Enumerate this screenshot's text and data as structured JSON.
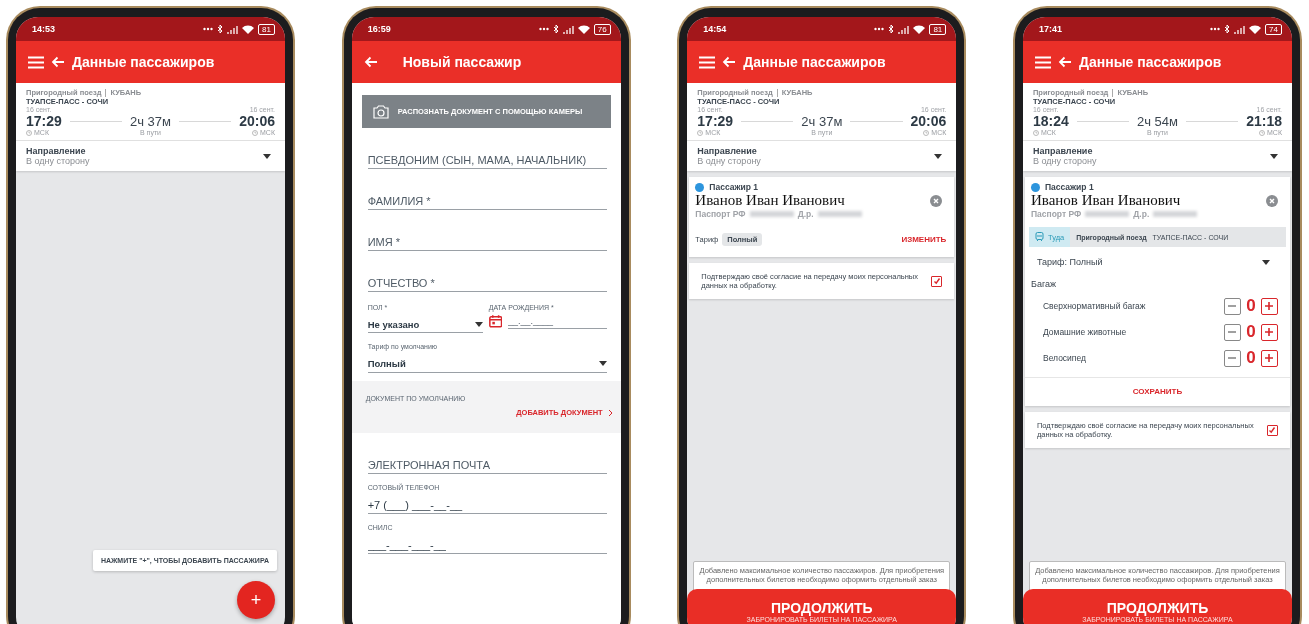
{
  "phones": [
    {
      "status_bar": {
        "time": "14:53",
        "battery": "81"
      },
      "app_bar": {
        "menu": true,
        "title": "Данные пассажиров"
      },
      "sections": [
        {
          "kind": "trip",
          "train_type": "Пригородный поезд",
          "carrier": "КУБАНЬ",
          "route": "ТУАПСЕ-ПАСС - СОЧИ",
          "depart_date": "16 сент.",
          "depart_time": "17:29",
          "depart_zone": "МСК",
          "duration": "2ч 37м",
          "duration_label": "В пути",
          "arrive_date": "16 сент.",
          "arrive_time": "20:06",
          "arrive_zone": "МСК"
        },
        {
          "kind": "direction",
          "label": "Направление",
          "value": "В одну сторону"
        }
      ],
      "hint": "НАЖМИТЕ \"+\", ЧТОБЫ ДОБАВИТЬ ПАССАЖИРА",
      "fab": "+"
    },
    {
      "status_bar": {
        "time": "16:59",
        "battery": "76"
      },
      "app_bar": {
        "menu": false,
        "title": "Новый пассажир"
      },
      "sections": [
        {
          "kind": "camera",
          "label": "РАСПОЗНАТЬ ДОКУМЕНТ С ПОМОЩЬЮ КАМЕРЫ"
        },
        {
          "kind": "input",
          "placeholder": "ПСЕВДОНИМ (СЫН, МАМА, НАЧАЛЬНИК)"
        },
        {
          "kind": "input",
          "placeholder": "ФАМИЛИЯ *"
        },
        {
          "kind": "input",
          "placeholder": "ИМЯ *"
        },
        {
          "kind": "input",
          "placeholder": "ОТЧЕСТВО *"
        },
        {
          "kind": "gender_date",
          "gender_label": "ПОЛ *",
          "gender_value": "Не указано",
          "date_label": "ДАТА РОЖДЕНИЯ *",
          "date_placeholder": "__.__.____"
        },
        {
          "kind": "select",
          "label": "Тариф по умолчанию",
          "value": "Полный"
        },
        {
          "kind": "document",
          "label": "ДОКУМЕНТ ПО УМОЛЧАНИЮ",
          "action": "ДОБАВИТЬ ДОКУМЕНТ"
        },
        {
          "kind": "input",
          "placeholder": "ЭЛЕКТРОННАЯ ПОЧТА"
        },
        {
          "kind": "labeled_input",
          "label": "СОТОВЫЙ ТЕЛЕФОН",
          "placeholder": "+7 (___) ___-__-__"
        },
        {
          "kind": "labeled_input",
          "label": "СНИЛС",
          "placeholder": "___-___-___-__"
        }
      ]
    },
    {
      "status_bar": {
        "time": "14:54",
        "battery": "81"
      },
      "app_bar": {
        "menu": true,
        "title": "Данные пассажиров"
      },
      "sections": [
        {
          "kind": "trip",
          "train_type": "Пригородный поезд",
          "carrier": "КУБАНЬ",
          "route": "ТУАПСЕ-ПАСС - СОЧИ",
          "depart_date": "16 сент.",
          "depart_time": "17:29",
          "depart_zone": "МСК",
          "duration": "2ч 37м",
          "duration_label": "В пути",
          "arrive_date": "16 сент.",
          "arrive_time": "20:06",
          "arrive_zone": "МСК"
        },
        {
          "kind": "direction",
          "label": "Направление",
          "value": "В одну сторону"
        },
        {
          "kind": "passenger",
          "tag": "Пассажир 1",
          "name": "Иванов Иван Иванович",
          "document": "Паспорт РФ",
          "birth": "Д.р.",
          "tariff_label": "Тариф",
          "tariff": "Полный",
          "edit": "ИЗМЕНИТЬ"
        },
        {
          "kind": "consent",
          "text": "Подтверждаю своё согласие на передачу моих персональных данных на обработку.",
          "checked": true
        }
      ],
      "footer": {
        "notice": "Добавлено максимальное количество пассажиров. Для приобретения дополнительных билетов необходимо оформить отдельный заказ",
        "button": "ПРОДОЛЖИТЬ",
        "subtitle": "ЗАБРОНИРОВАТЬ БИЛЕТЫ НА ПАССАЖИРА"
      }
    },
    {
      "status_bar": {
        "time": "17:41",
        "battery": "74"
      },
      "app_bar": {
        "menu": true,
        "title": "Данные пассажиров"
      },
      "sections": [
        {
          "kind": "trip",
          "train_type": "Пригородный поезд",
          "carrier": "КУБАНЬ",
          "route": "ТУАПСЕ-ПАСС - СОЧИ",
          "depart_date": "16 сент.",
          "depart_time": "18:24",
          "depart_zone": "МСК",
          "duration": "2ч 54м",
          "duration_label": "В пути",
          "arrive_date": "16 сент.",
          "arrive_time": "21:18",
          "arrive_zone": "МСК"
        },
        {
          "kind": "direction",
          "label": "Направление",
          "value": "В одну сторону"
        },
        {
          "kind": "passenger_edit",
          "tag": "Пассажир 1",
          "name": "Иванов Иван Иванович",
          "document": "Паспорт РФ",
          "birth": "Д.р.",
          "segment_direction": "Туда",
          "segment_train": "Пригородный поезд",
          "segment_route": "ТУАПСЕ-ПАСС - СОЧИ",
          "tariff": "Тариф: Полный",
          "baggage_title": "Багаж",
          "baggage": [
            {
              "label": "Сверхнормативный багаж",
              "count": "0"
            },
            {
              "label": "Домашние животные",
              "count": "0"
            },
            {
              "label": "Велосипед",
              "count": "0"
            }
          ],
          "save": "СОХРАНИТЬ"
        },
        {
          "kind": "consent",
          "text": "Подтверждаю своё согласие на передачу моих персональных данных на обработку.",
          "checked": true
        }
      ],
      "footer": {
        "notice": "Добавлено максимальное количество пассажиров. Для приобретения дополнительных билетов необходимо оформить отдельный заказ",
        "button": "ПРОДОЛЖИТЬ",
        "subtitle": "ЗАБРОНИРОВАТЬ БИЛЕТЫ НА ПАССАЖИРА"
      }
    }
  ]
}
